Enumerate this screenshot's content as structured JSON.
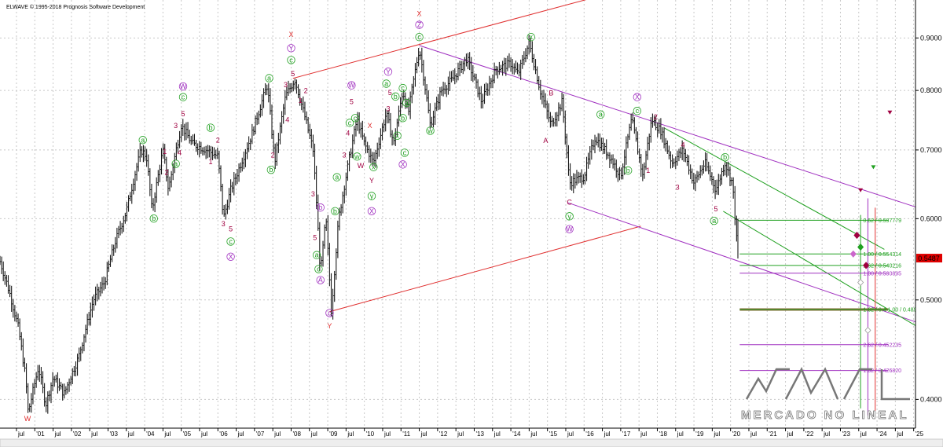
{
  "app_header": {
    "title": "ELWAVE © 1995-2018 Prognosis Software Development"
  },
  "logo": {
    "text": "MERCADO NO LINEAL"
  },
  "chart_data": {
    "type": "ohlc",
    "title": "",
    "xlabel": "",
    "ylabel": "",
    "scale": "log",
    "ylim": [
      0.375,
      0.98
    ],
    "y_ticks": [
      {
        "value": 0.9,
        "label": "0.9000"
      },
      {
        "value": 0.8,
        "label": "0.8000"
      },
      {
        "value": 0.7,
        "label": "0.7000"
      },
      {
        "value": 0.6,
        "label": "0.6000"
      },
      {
        "value": 0.5,
        "label": "0.5000"
      },
      {
        "value": 0.4,
        "label": "0.4000"
      }
    ],
    "last_price_label": {
      "text": "0.5487",
      "value": 0.5487,
      "color": "#e00000"
    },
    "x_range": [
      2000.05,
      2025.05
    ],
    "x_ticks": [
      {
        "t": 2000.5,
        "label": "jul"
      },
      {
        "t": 2001.0,
        "label": "'01"
      },
      {
        "t": 2001.5,
        "label": "jul"
      },
      {
        "t": 2002.0,
        "label": "'02"
      },
      {
        "t": 2002.5,
        "label": "jul"
      },
      {
        "t": 2003.0,
        "label": "'03"
      },
      {
        "t": 2003.5,
        "label": "jul"
      },
      {
        "t": 2004.0,
        "label": "'04"
      },
      {
        "t": 2004.5,
        "label": "jul"
      },
      {
        "t": 2005.0,
        "label": "'05"
      },
      {
        "t": 2005.5,
        "label": "jul"
      },
      {
        "t": 2006.0,
        "label": "'06"
      },
      {
        "t": 2006.5,
        "label": "jul"
      },
      {
        "t": 2007.0,
        "label": "'07"
      },
      {
        "t": 2007.5,
        "label": "jul"
      },
      {
        "t": 2008.0,
        "label": "'08"
      },
      {
        "t": 2008.5,
        "label": "jul"
      },
      {
        "t": 2009.0,
        "label": "'09"
      },
      {
        "t": 2009.5,
        "label": "jul"
      },
      {
        "t": 2010.0,
        "label": "'10"
      },
      {
        "t": 2010.5,
        "label": "jul"
      },
      {
        "t": 2011.0,
        "label": "'11"
      },
      {
        "t": 2011.5,
        "label": "jul"
      },
      {
        "t": 2012.0,
        "label": "'12"
      },
      {
        "t": 2012.5,
        "label": "jul"
      },
      {
        "t": 2013.0,
        "label": "'13"
      },
      {
        "t": 2013.5,
        "label": "jul"
      },
      {
        "t": 2014.0,
        "label": "'14"
      },
      {
        "t": 2014.5,
        "label": "jul"
      },
      {
        "t": 2015.0,
        "label": "'15"
      },
      {
        "t": 2015.5,
        "label": "jul"
      },
      {
        "t": 2016.0,
        "label": "'16"
      },
      {
        "t": 2016.5,
        "label": "jul"
      },
      {
        "t": 2017.0,
        "label": "'17"
      },
      {
        "t": 2017.5,
        "label": "jul"
      },
      {
        "t": 2018.0,
        "label": "'18"
      },
      {
        "t": 2018.5,
        "label": "jul"
      },
      {
        "t": 2019.0,
        "label": "'19"
      },
      {
        "t": 2019.5,
        "label": "jul"
      },
      {
        "t": 2020.0,
        "label": "'20"
      },
      {
        "t": 2020.5,
        "label": "jul"
      },
      {
        "t": 2021.0,
        "label": "'21"
      },
      {
        "t": 2021.5,
        "label": "jul"
      },
      {
        "t": 2022.0,
        "label": "'22"
      },
      {
        "t": 2022.5,
        "label": "jul"
      },
      {
        "t": 2023.0,
        "label": "'23"
      },
      {
        "t": 2023.5,
        "label": "jul"
      },
      {
        "t": 2024.0,
        "label": "'24"
      },
      {
        "t": 2024.5,
        "label": "jul"
      },
      {
        "t": 2025.0,
        "label": "'25"
      }
    ],
    "grid": true,
    "price_path": [
      [
        2000.05,
        0.545
      ],
      [
        2000.3,
        0.51
      ],
      [
        2000.55,
        0.47
      ],
      [
        2000.75,
        0.42
      ],
      [
        2000.82,
        0.388
      ],
      [
        2001.1,
        0.43
      ],
      [
        2001.3,
        0.395
      ],
      [
        2001.5,
        0.42
      ],
      [
        2001.8,
        0.405
      ],
      [
        2002.2,
        0.44
      ],
      [
        2002.6,
        0.5
      ],
      [
        2002.9,
        0.52
      ],
      [
        2003.2,
        0.57
      ],
      [
        2003.5,
        0.61
      ],
      [
        2003.9,
        0.7
      ],
      [
        2004.05,
        0.69
      ],
      [
        2004.2,
        0.61
      ],
      [
        2004.5,
        0.7
      ],
      [
        2004.65,
        0.64
      ],
      [
        2005.0,
        0.74
      ],
      [
        2005.3,
        0.71
      ],
      [
        2005.7,
        0.7
      ],
      [
        2006.0,
        0.69
      ],
      [
        2006.15,
        0.6
      ],
      [
        2006.35,
        0.64
      ],
      [
        2006.5,
        0.66
      ],
      [
        2006.9,
        0.72
      ],
      [
        2007.35,
        0.81
      ],
      [
        2007.55,
        0.68
      ],
      [
        2007.85,
        0.79
      ],
      [
        2008.1,
        0.82
      ],
      [
        2008.35,
        0.76
      ],
      [
        2008.6,
        0.7
      ],
      [
        2008.8,
        0.53
      ],
      [
        2008.95,
        0.6
      ],
      [
        2009.1,
        0.485
      ],
      [
        2009.3,
        0.6
      ],
      [
        2009.6,
        0.69
      ],
      [
        2009.8,
        0.75
      ],
      [
        2010.0,
        0.71
      ],
      [
        2010.25,
        0.68
      ],
      [
        2010.6,
        0.76
      ],
      [
        2010.8,
        0.71
      ],
      [
        2011.05,
        0.8
      ],
      [
        2011.2,
        0.76
      ],
      [
        2011.5,
        0.88
      ],
      [
        2011.8,
        0.74
      ],
      [
        2012.1,
        0.8
      ],
      [
        2012.4,
        0.82
      ],
      [
        2012.8,
        0.86
      ],
      [
        2013.2,
        0.78
      ],
      [
        2013.6,
        0.84
      ],
      [
        2014.0,
        0.85
      ],
      [
        2014.2,
        0.83
      ],
      [
        2014.5,
        0.89
      ],
      [
        2014.8,
        0.8
      ],
      [
        2015.1,
        0.74
      ],
      [
        2015.4,
        0.78
      ],
      [
        2015.6,
        0.65
      ],
      [
        2016.0,
        0.66
      ],
      [
        2016.3,
        0.72
      ],
      [
        2016.7,
        0.69
      ],
      [
        2017.0,
        0.66
      ],
      [
        2017.3,
        0.75
      ],
      [
        2017.6,
        0.66
      ],
      [
        2017.85,
        0.75
      ],
      [
        2018.1,
        0.73
      ],
      [
        2018.4,
        0.68
      ],
      [
        2018.7,
        0.7
      ],
      [
        2019.0,
        0.65
      ],
      [
        2019.3,
        0.68
      ],
      [
        2019.6,
        0.64
      ],
      [
        2019.85,
        0.68
      ],
      [
        2020.05,
        0.65
      ],
      [
        2020.2,
        0.55
      ]
    ],
    "channel_lines": [
      {
        "name": "red-upper-channel",
        "color": "#e03030",
        "x1": 2008.05,
        "y1": 0.822,
        "x2": 2016.25,
        "y2": 0.985
      },
      {
        "name": "red-lower-channel",
        "color": "#e03030",
        "x1": 2009.05,
        "y1": 0.487,
        "x2": 2017.55,
        "y2": 0.59
      },
      {
        "name": "purple-upper-channel",
        "color": "#a030c0",
        "x1": 2011.5,
        "y1": 0.885,
        "x2": 2025.05,
        "y2": 0.616
      },
      {
        "name": "purple-lower-channel",
        "color": "#a030c0",
        "x1": 2015.55,
        "y1": 0.622,
        "x2": 2025.05,
        "y2": 0.476
      },
      {
        "name": "green-channel-upper",
        "color": "#20a020",
        "x1": 2018.2,
        "y1": 0.735,
        "x2": 2024.2,
        "y2": 0.56
      },
      {
        "name": "green-channel-lower",
        "color": "#20a020",
        "x1": 2019.8,
        "y1": 0.61,
        "x2": 2025.05,
        "y2": 0.472
      }
    ],
    "fib_levels": [
      {
        "label": "0.62 / 0.597779",
        "value": 0.5978,
        "color": "#20a020"
      },
      {
        "label": "1.00 / 0.554314",
        "value": 0.5543,
        "color": "#20a020"
      },
      {
        "label": "1.62 / 0.540216",
        "value": 0.5402,
        "color": "#20a020"
      },
      {
        "label": "1.00 / 0.530895",
        "value": 0.5309,
        "color": "#a030c0"
      },
      {
        "label": "1.62 / 0.4 1.00 / 0.489390",
        "value": 0.4894,
        "color": "#20a020"
      },
      {
        "label": "2.62 / 0.452235",
        "value": 0.4522,
        "color": "#a030c0"
      },
      {
        "label": "1.62 / 0.426820",
        "value": 0.4268,
        "color": "#a030c0"
      }
    ],
    "fib_x_start": 2020.25,
    "fib_x_end": 2024.3,
    "support_band": {
      "value": 0.4894,
      "color": "#8b6a3a"
    },
    "target_verticals": [
      {
        "name": "green-target-vertical",
        "color": "#20a020",
        "x": 2023.55,
        "y_top": 0.605,
        "y_bottom": 0.392
      },
      {
        "name": "purple-target-vertical",
        "color": "#a030c0",
        "x": 2023.75,
        "y_top": 0.628,
        "y_bottom": 0.386
      },
      {
        "name": "red-target-vertical",
        "color": "#e03030",
        "x": 2023.95,
        "y_top": 0.615,
        "y_bottom": 0.39
      }
    ],
    "target_markers": [
      {
        "shape": "tri-down",
        "x": 2024.35,
        "y": 0.762,
        "color": "#a00040"
      },
      {
        "shape": "tri-down",
        "x": 2023.9,
        "y": 0.674,
        "color": "#20a020"
      },
      {
        "shape": "tri-down",
        "x": 2023.55,
        "y": 0.64,
        "color": "#a00040"
      },
      {
        "shape": "diamond",
        "x": 2023.45,
        "y": 0.578,
        "color": "#a00040"
      },
      {
        "shape": "diamond",
        "x": 2023.55,
        "y": 0.563,
        "color": "#20a020"
      },
      {
        "shape": "diamond",
        "x": 2023.35,
        "y": 0.5543,
        "color": "#cc66cc"
      },
      {
        "shape": "diamond",
        "x": 2023.7,
        "y": 0.5402,
        "color": "#a00040"
      },
      {
        "shape": "diamond",
        "x": 2023.55,
        "y": 0.52,
        "color": "#cccccc"
      },
      {
        "shape": "diamond",
        "x": 2023.75,
        "y": 0.467,
        "color": "#cccccc"
      }
    ],
    "wave_labels": [
      {
        "text": "W",
        "x": 2000.8,
        "y": 0.381,
        "color": "#e03030"
      },
      {
        "text": "(a)",
        "x": 2003.95,
        "y": 0.712,
        "color": "#20a020"
      },
      {
        "text": "(b)",
        "x": 2004.25,
        "y": 0.597,
        "color": "#20a020"
      },
      {
        "text": "1",
        "x": 2004.55,
        "y": 0.694,
        "color": "#a00040"
      },
      {
        "text": "2",
        "x": 2004.6,
        "y": 0.662,
        "color": "#a00040"
      },
      {
        "text": "3",
        "x": 2004.85,
        "y": 0.735,
        "color": "#a00040"
      },
      {
        "text": "4",
        "x": 2004.95,
        "y": 0.692,
        "color": "#a00040"
      },
      {
        "text": "5",
        "x": 2005.05,
        "y": 0.755,
        "color": "#a00040"
      },
      {
        "text": "(c)",
        "x": 2005.05,
        "y": 0.784,
        "color": "#20a020"
      },
      {
        "text": "(a)",
        "x": 2004.85,
        "y": 0.675,
        "color": "#20a020"
      },
      {
        "text": "W",
        "x": 2005.05,
        "y": 0.803,
        "color": "#a030c0"
      },
      {
        "text": "(b)",
        "x": 2005.8,
        "y": 0.732,
        "color": "#20a020"
      },
      {
        "text": "2",
        "x": 2006.0,
        "y": 0.712,
        "color": "#a00040"
      },
      {
        "text": "1",
        "x": 2005.8,
        "y": 0.678,
        "color": "#a00040"
      },
      {
        "text": "3",
        "x": 2006.15,
        "y": 0.59,
        "color": "#a00040"
      },
      {
        "text": "5",
        "x": 2006.35,
        "y": 0.583,
        "color": "#a00040"
      },
      {
        "text": "(c)",
        "x": 2006.35,
        "y": 0.567,
        "color": "#20a020"
      },
      {
        "text": "X",
        "x": 2006.35,
        "y": 0.548,
        "color": "#a030c0"
      },
      {
        "text": "(a)",
        "x": 2007.4,
        "y": 0.818,
        "color": "#20a020"
      },
      {
        "text": "(b)",
        "x": 2007.45,
        "y": 0.666,
        "color": "#20a020"
      },
      {
        "text": "2",
        "x": 2007.5,
        "y": 0.688,
        "color": "#a00040"
      },
      {
        "text": "3",
        "x": 2007.85,
        "y": 0.806,
        "color": "#a00040"
      },
      {
        "text": "4",
        "x": 2007.9,
        "y": 0.745,
        "color": "#a00040"
      },
      {
        "text": "5",
        "x": 2008.05,
        "y": 0.826,
        "color": "#a00040"
      },
      {
        "text": "(c)",
        "x": 2008.0,
        "y": 0.852,
        "color": "#20a020"
      },
      {
        "text": "Y",
        "x": 2008.0,
        "y": 0.875,
        "color": "#a030c0"
      },
      {
        "text": "X",
        "x": 2008.0,
        "y": 0.902,
        "color": "#e03030"
      },
      {
        "text": "1",
        "x": 2008.25,
        "y": 0.778,
        "color": "#a00040"
      },
      {
        "text": "2",
        "x": 2008.4,
        "y": 0.795,
        "color": "#a00040"
      },
      {
        "text": "3",
        "x": 2008.6,
        "y": 0.631,
        "color": "#a00040"
      },
      {
        "text": "(b)",
        "x": 2008.8,
        "y": 0.612,
        "color": "#a030c0"
      },
      {
        "text": "5",
        "x": 2008.65,
        "y": 0.572,
        "color": "#a00040"
      },
      {
        "text": "(a)",
        "x": 2008.7,
        "y": 0.55,
        "color": "#20a020"
      },
      {
        "text": "(c)",
        "x": 2008.75,
        "y": 0.533,
        "color": "#20a020"
      },
      {
        "text": "(A)",
        "x": 2008.8,
        "y": 0.52,
        "color": "#a030c0"
      },
      {
        "text": "(c)",
        "x": 2009.05,
        "y": 0.483,
        "color": "#a030c0"
      },
      {
        "text": "Y",
        "x": 2009.05,
        "y": 0.469,
        "color": "#e03030"
      },
      {
        "text": "(a)",
        "x": 2009.25,
        "y": 0.655,
        "color": "#20a020"
      },
      {
        "text": "(b)",
        "x": 2009.2,
        "y": 0.607,
        "color": "#20a020"
      },
      {
        "text": "3",
        "x": 2009.45,
        "y": 0.688,
        "color": "#a00040"
      },
      {
        "text": "4",
        "x": 2009.55,
        "y": 0.723,
        "color": "#a00040"
      },
      {
        "text": "5",
        "x": 2009.65,
        "y": 0.776,
        "color": "#a00040"
      },
      {
        "text": "(c)",
        "x": 2009.75,
        "y": 0.748,
        "color": "#20a020"
      },
      {
        "text": "(c)",
        "x": 2009.6,
        "y": 0.74,
        "color": "#20a020"
      },
      {
        "text": "W",
        "x": 2009.65,
        "y": 0.805,
        "color": "#a030c0"
      },
      {
        "text": "(w)",
        "x": 2009.8,
        "y": 0.686,
        "color": "#20a020"
      },
      {
        "text": "W",
        "x": 2009.9,
        "y": 0.672,
        "color": "#a00040"
      },
      {
        "text": "(x)",
        "x": 2010.25,
        "y": 0.67,
        "color": "#20a020"
      },
      {
        "text": "X",
        "x": 2010.15,
        "y": 0.735,
        "color": "#e03030"
      },
      {
        "text": "Y",
        "x": 2010.2,
        "y": 0.65,
        "color": "#a00040"
      },
      {
        "text": "(y)",
        "x": 2010.2,
        "y": 0.628,
        "color": "#20a020"
      },
      {
        "text": "X",
        "x": 2010.2,
        "y": 0.607,
        "color": "#a030c0"
      },
      {
        "text": "(a)",
        "x": 2010.6,
        "y": 0.808,
        "color": "#20a020"
      },
      {
        "text": "Y",
        "x": 2010.65,
        "y": 0.83,
        "color": "#a030c0"
      },
      {
        "text": "5",
        "x": 2010.7,
        "y": 0.792,
        "color": "#a00040"
      },
      {
        "text": "(b)",
        "x": 2010.85,
        "y": 0.785,
        "color": "#20a020"
      },
      {
        "text": "3",
        "x": 2010.65,
        "y": 0.764,
        "color": "#a00040"
      },
      {
        "text": "(c)",
        "x": 2011.05,
        "y": 0.8,
        "color": "#20a020"
      },
      {
        "text": "(a)",
        "x": 2011.15,
        "y": 0.774,
        "color": "#20a020"
      },
      {
        "text": "(b)",
        "x": 2011.05,
        "y": 0.748,
        "color": "#20a020"
      },
      {
        "text": "(x)",
        "x": 2010.9,
        "y": 0.719,
        "color": "#20a020"
      },
      {
        "text": "(c)",
        "x": 2011.1,
        "y": 0.692,
        "color": "#20a020"
      },
      {
        "text": "X",
        "x": 2011.05,
        "y": 0.674,
        "color": "#a030c0"
      },
      {
        "text": "X",
        "x": 2011.5,
        "y": 0.945,
        "color": "#e03030"
      },
      {
        "text": "Z",
        "x": 2011.5,
        "y": 0.922,
        "color": "#a030c0"
      },
      {
        "text": "(c)",
        "x": 2011.5,
        "y": 0.897,
        "color": "#20a020"
      },
      {
        "text": "(w)",
        "x": 2011.8,
        "y": 0.727,
        "color": "#20a020"
      },
      {
        "text": "(x)",
        "x": 2014.55,
        "y": 0.897,
        "color": "#20a020"
      },
      {
        "text": "B",
        "x": 2015.1,
        "y": 0.791,
        "color": "#a00040"
      },
      {
        "text": "A",
        "x": 2014.95,
        "y": 0.711,
        "color": "#a00040"
      },
      {
        "text": "C",
        "x": 2015.6,
        "y": 0.619,
        "color": "#a00040"
      },
      {
        "text": "(y)",
        "x": 2015.6,
        "y": 0.6,
        "color": "#20a020"
      },
      {
        "text": "W",
        "x": 2015.6,
        "y": 0.583,
        "color": "#a030c0"
      },
      {
        "text": "(a)",
        "x": 2016.45,
        "y": 0.754,
        "color": "#20a020"
      },
      {
        "text": "(b)",
        "x": 2017.2,
        "y": 0.665,
        "color": "#20a020"
      },
      {
        "text": "(c)",
        "x": 2017.45,
        "y": 0.76,
        "color": "#20a020"
      },
      {
        "text": "X",
        "x": 2017.45,
        "y": 0.784,
        "color": "#a030c0"
      },
      {
        "text": "1",
        "x": 2017.75,
        "y": 0.665,
        "color": "#a00040"
      },
      {
        "text": "2",
        "x": 2017.95,
        "y": 0.75,
        "color": "#a00040"
      },
      {
        "text": "3",
        "x": 2018.55,
        "y": 0.64,
        "color": "#a00040"
      },
      {
        "text": "4",
        "x": 2018.7,
        "y": 0.704,
        "color": "#a00040"
      },
      {
        "text": "5",
        "x": 2019.6,
        "y": 0.61,
        "color": "#a00040"
      },
      {
        "text": "(a)",
        "x": 2019.55,
        "y": 0.594,
        "color": "#20a020"
      },
      {
        "text": "(b)",
        "x": 2019.85,
        "y": 0.685,
        "color": "#20a020"
      }
    ]
  }
}
